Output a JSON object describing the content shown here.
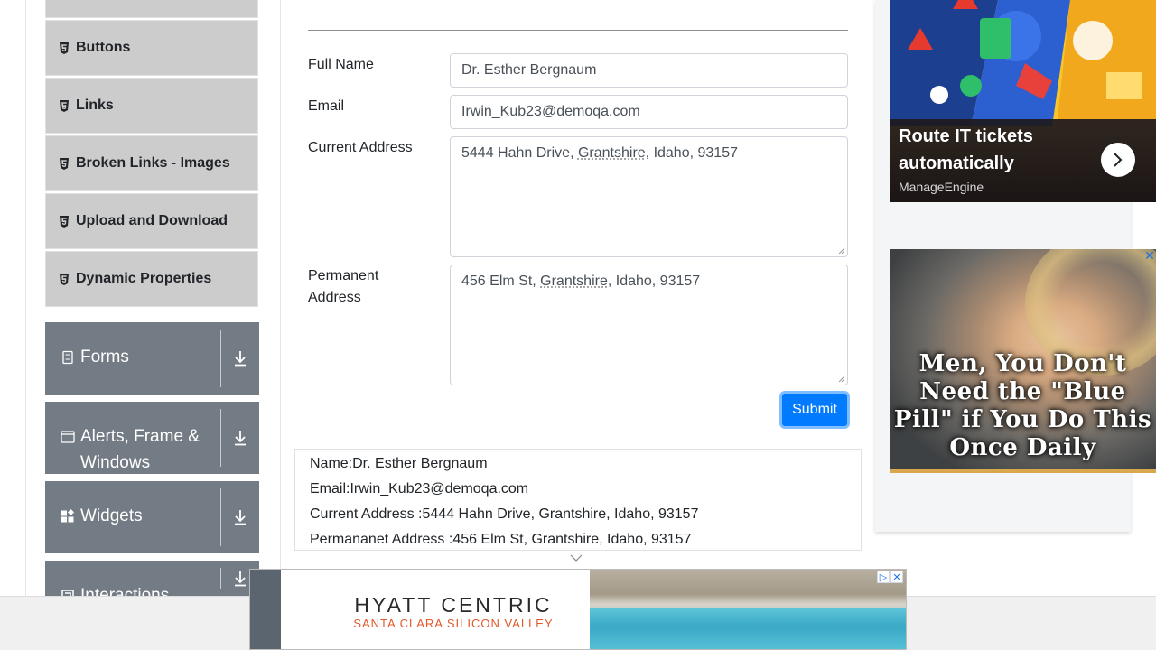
{
  "sidebar": {
    "sub_items": [
      {
        "label": "Buttons"
      },
      {
        "label": "Links"
      },
      {
        "label": "Broken Links - Images"
      },
      {
        "label": "Upload and Download"
      },
      {
        "label": "Dynamic Properties"
      }
    ],
    "groups": [
      {
        "label": "Forms",
        "icon": "document-icon"
      },
      {
        "label": "Alerts, Frame & Windows",
        "icon": "window-icon"
      },
      {
        "label": "Widgets",
        "icon": "widgets-icon"
      },
      {
        "label": "Interactions",
        "icon": "interactions-icon"
      }
    ]
  },
  "form": {
    "full_name_label": "Full Name",
    "full_name_value": "Dr. Esther Bergnaum",
    "email_label": "Email",
    "email_value": "Irwin_Kub23@demoqa.com",
    "current_address_label": "Current Address",
    "current_address_pre": "5444 Hahn Drive, ",
    "current_address_city": "Grantshire",
    "current_address_post": ", Idaho, 93157",
    "permanent_address_label_1": "Permanent",
    "permanent_address_label_2": "Address",
    "permanent_address_pre": "456 Elm St, ",
    "permanent_address_city": "Grantshire",
    "permanent_address_post": ", Idaho, 93157",
    "submit_label": "Submit"
  },
  "output": {
    "name": "Name:Dr. Esther Bergnaum",
    "email": "Email:Irwin_Kub23@demoqa.com",
    "current_address": "Current Address :5444 Hahn Drive, Grantshire, Idaho, 93157",
    "permanent_address": "Permananet Address :456 Elm St, Grantshire, Idaho, 93157"
  },
  "ads": {
    "ad1_headline": "Route IT tickets automatically",
    "ad1_brand": "ManageEngine",
    "ad2_text": "Men, You Don't Need the \"Blue Pill\" if You Do This Once Daily",
    "ad2_close": "✕",
    "banner_logo_line1": "HYATT CENTRIC",
    "banner_logo_line2": "SANTA CLARA SILICON VALLEY",
    "banner_adchoice": "▷",
    "banner_close": "✕"
  },
  "colors": {
    "accent": "#007bff",
    "sidebar_group": "#737b85",
    "sidebar_item": "#cccccc"
  }
}
